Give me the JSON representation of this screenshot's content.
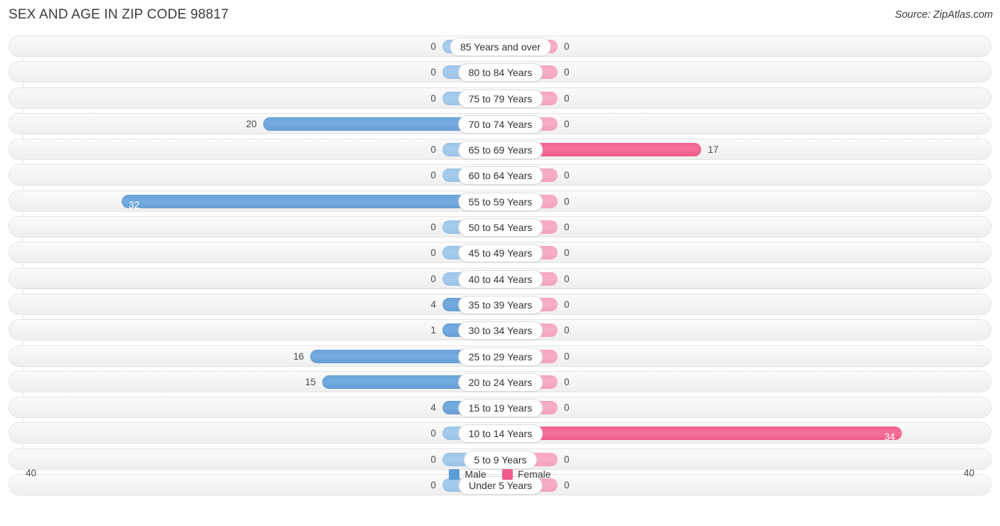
{
  "header": {
    "title": "SEX AND AGE IN ZIP CODE 98817",
    "source": "Source: ZipAtlas.com"
  },
  "legend": {
    "male_label": "Male",
    "female_label": "Female",
    "male_color": "#5b9bd5",
    "female_color": "#ef5c8c"
  },
  "axis": {
    "left_tick": "40",
    "right_tick": "40"
  },
  "chart_data": {
    "type": "bar",
    "subtype": "population-pyramid",
    "title": "SEX AND AGE IN ZIP CODE 98817",
    "xlabel": "",
    "ylabel": "",
    "xlim": [
      40,
      40
    ],
    "axis_max": 40,
    "grid": true,
    "legend_position": "bottom-center",
    "orientation": "horizontal-diverging",
    "categories": [
      "85 Years and over",
      "80 to 84 Years",
      "75 to 79 Years",
      "70 to 74 Years",
      "65 to 69 Years",
      "60 to 64 Years",
      "55 to 59 Years",
      "50 to 54 Years",
      "45 to 49 Years",
      "40 to 44 Years",
      "35 to 39 Years",
      "30 to 34 Years",
      "25 to 29 Years",
      "20 to 24 Years",
      "15 to 19 Years",
      "10 to 14 Years",
      "5 to 9 Years",
      "Under 5 Years"
    ],
    "series": [
      {
        "name": "Male",
        "color": "#5b9bd5",
        "values": [
          0,
          0,
          0,
          20,
          0,
          0,
          32,
          0,
          0,
          0,
          4,
          1,
          16,
          15,
          4,
          0,
          0,
          0
        ]
      },
      {
        "name": "Female",
        "color": "#ef5c8c",
        "values": [
          0,
          0,
          0,
          0,
          17,
          0,
          0,
          0,
          0,
          0,
          0,
          0,
          0,
          0,
          0,
          34,
          0,
          0
        ]
      }
    ]
  }
}
